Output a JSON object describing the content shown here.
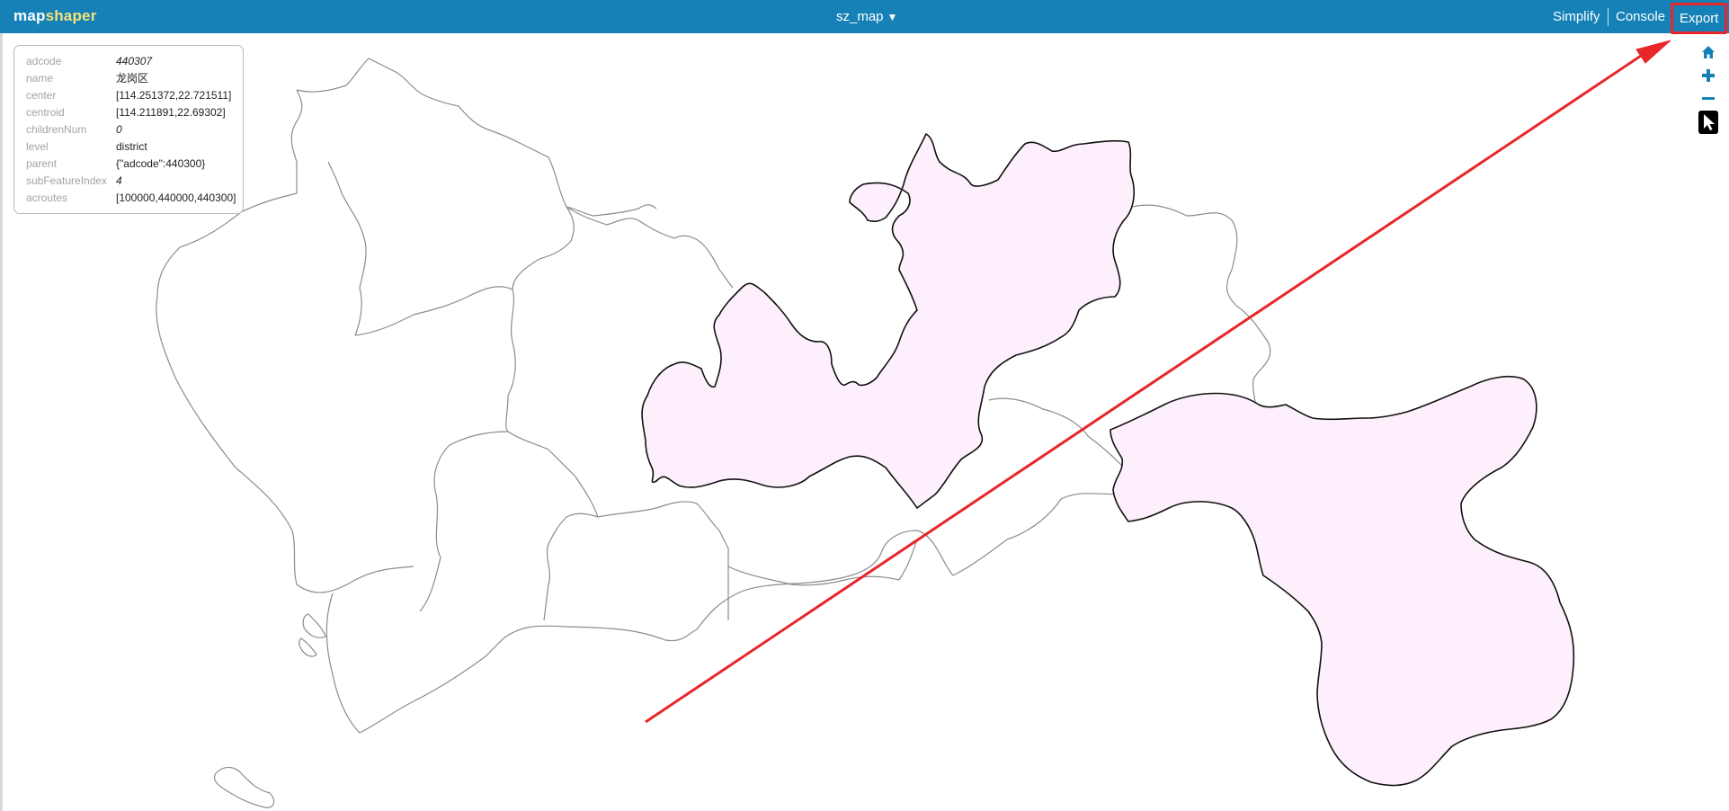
{
  "app": {
    "logo_part1": "map",
    "logo_part2": "shaper",
    "layer_name": "sz_map",
    "layer_caret": "▼"
  },
  "nav": {
    "simplify": "Simplify",
    "console": "Console",
    "export": "Export"
  },
  "colors": {
    "topbar": "#1581b7",
    "logo_accent": "#f6e27a",
    "selected_fill": "#fdf0fc",
    "annotation_red": "#e8262a"
  },
  "feature_info": {
    "rows": [
      {
        "key": "adcode",
        "value": "440307"
      },
      {
        "key": "name",
        "value": "龙岗区"
      },
      {
        "key": "center",
        "value": "[114.251372,22.721511]"
      },
      {
        "key": "centroid",
        "value": "[114.211891,22.69302]"
      },
      {
        "key": "childrenNum",
        "value": "0"
      },
      {
        "key": "level",
        "value": "district"
      },
      {
        "key": "parent",
        "value": "{\"adcode\":440300}"
      },
      {
        "key": "subFeatureIndex",
        "value": "4"
      },
      {
        "key": "acroutes",
        "value": "[100000,440000,440300]"
      }
    ]
  },
  "tools": [
    "home-icon",
    "zoom-in-icon",
    "zoom-out-icon",
    "pointer-icon"
  ]
}
